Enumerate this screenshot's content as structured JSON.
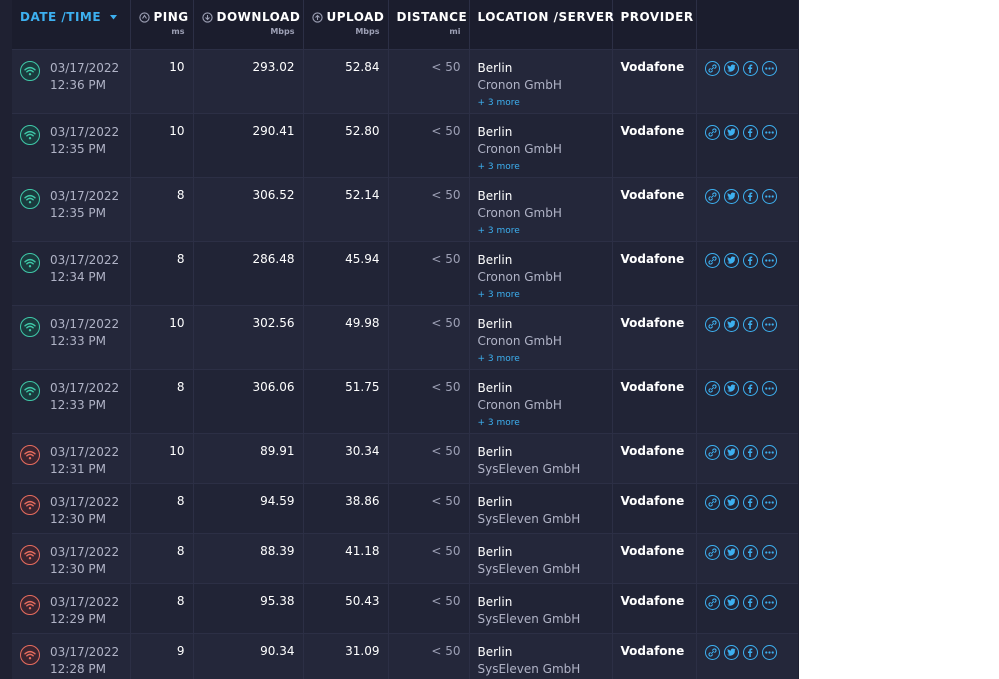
{
  "colors": {
    "panel_bg": "#1f2132",
    "accent": "#3db0f0",
    "good_connection": "#3fc8a8",
    "poor_connection": "#e76c5e"
  },
  "columns": {
    "datetime": "DATE /TIME",
    "ping": "PING",
    "ping_unit": "ms",
    "download": "DOWNLOAD",
    "download_unit": "Mbps",
    "upload": "UPLOAD",
    "upload_unit": "Mbps",
    "distance": "DISTANCE",
    "distance_unit": "mi",
    "location": "LOCATION /SERVER",
    "provider": "PROVIDER"
  },
  "icons": {
    "sort": "chevron-down-icon",
    "ping": "ping-icon",
    "download": "download-icon",
    "upload": "upload-icon",
    "connection": "wifi-icon",
    "actions": [
      "link-icon",
      "twitter-icon",
      "facebook-icon",
      "more-icon"
    ]
  },
  "rows": [
    {
      "date": "03/17/2022",
      "time": "12:36 PM",
      "ping": "10",
      "download": "293.02",
      "upload": "52.84",
      "distance": "< 50",
      "city": "Berlin",
      "server": "Cronon GmbH",
      "more": "+ 3 more",
      "provider": "Vodafone",
      "quality": "good"
    },
    {
      "date": "03/17/2022",
      "time": "12:35 PM",
      "ping": "10",
      "download": "290.41",
      "upload": "52.80",
      "distance": "< 50",
      "city": "Berlin",
      "server": "Cronon GmbH",
      "more": "+ 3 more",
      "provider": "Vodafone",
      "quality": "good"
    },
    {
      "date": "03/17/2022",
      "time": "12:35 PM",
      "ping": "8",
      "download": "306.52",
      "upload": "52.14",
      "distance": "< 50",
      "city": "Berlin",
      "server": "Cronon GmbH",
      "more": "+ 3 more",
      "provider": "Vodafone",
      "quality": "good"
    },
    {
      "date": "03/17/2022",
      "time": "12:34 PM",
      "ping": "8",
      "download": "286.48",
      "upload": "45.94",
      "distance": "< 50",
      "city": "Berlin",
      "server": "Cronon GmbH",
      "more": "+ 3 more",
      "provider": "Vodafone",
      "quality": "good"
    },
    {
      "date": "03/17/2022",
      "time": "12:33 PM",
      "ping": "10",
      "download": "302.56",
      "upload": "49.98",
      "distance": "< 50",
      "city": "Berlin",
      "server": "Cronon GmbH",
      "more": "+ 3 more",
      "provider": "Vodafone",
      "quality": "good"
    },
    {
      "date": "03/17/2022",
      "time": "12:33 PM",
      "ping": "8",
      "download": "306.06",
      "upload": "51.75",
      "distance": "< 50",
      "city": "Berlin",
      "server": "Cronon GmbH",
      "more": "+ 3 more",
      "provider": "Vodafone",
      "quality": "good"
    },
    {
      "date": "03/17/2022",
      "time": "12:31 PM",
      "ping": "10",
      "download": "89.91",
      "upload": "30.34",
      "distance": "< 50",
      "city": "Berlin",
      "server": "SysEleven GmbH",
      "more": "",
      "provider": "Vodafone",
      "quality": "poor"
    },
    {
      "date": "03/17/2022",
      "time": "12:30 PM",
      "ping": "8",
      "download": "94.59",
      "upload": "38.86",
      "distance": "< 50",
      "city": "Berlin",
      "server": "SysEleven GmbH",
      "more": "",
      "provider": "Vodafone",
      "quality": "poor"
    },
    {
      "date": "03/17/2022",
      "time": "12:30 PM",
      "ping": "8",
      "download": "88.39",
      "upload": "41.18",
      "distance": "< 50",
      "city": "Berlin",
      "server": "SysEleven GmbH",
      "more": "",
      "provider": "Vodafone",
      "quality": "poor"
    },
    {
      "date": "03/17/2022",
      "time": "12:29 PM",
      "ping": "8",
      "download": "95.38",
      "upload": "50.43",
      "distance": "< 50",
      "city": "Berlin",
      "server": "SysEleven GmbH",
      "more": "",
      "provider": "Vodafone",
      "quality": "poor"
    },
    {
      "date": "03/17/2022",
      "time": "12:28 PM",
      "ping": "9",
      "download": "90.34",
      "upload": "31.09",
      "distance": "< 50",
      "city": "Berlin",
      "server": "SysEleven GmbH",
      "more": "",
      "provider": "Vodafone",
      "quality": "poor"
    }
  ]
}
